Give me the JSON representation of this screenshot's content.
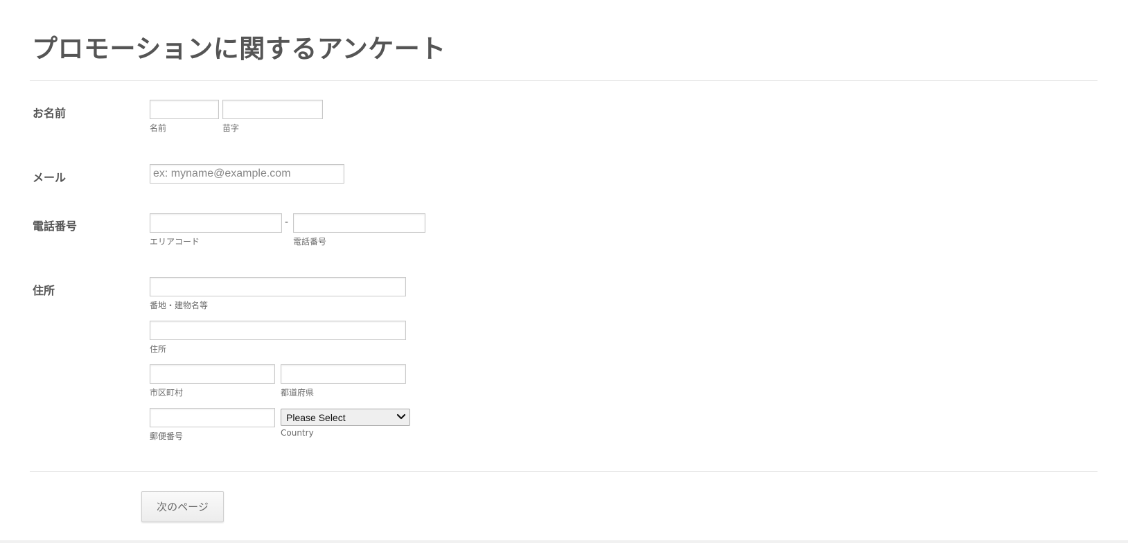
{
  "form": {
    "title": "プロモーションに関するアンケート"
  },
  "name": {
    "label": "お名前",
    "first": {
      "value": "",
      "sublabel": "名前"
    },
    "last": {
      "value": "",
      "sublabel": "苗字"
    }
  },
  "email": {
    "label": "メール",
    "value": "",
    "placeholder": "ex: myname@example.com"
  },
  "phone": {
    "label": "電話番号",
    "separator": "-",
    "area_code": {
      "value": "",
      "sublabel": "エリアコード"
    },
    "number": {
      "value": "",
      "sublabel": "電話番号"
    }
  },
  "address": {
    "label": "住所",
    "street1": {
      "value": "",
      "sublabel": "番地・建物名等"
    },
    "street2": {
      "value": "",
      "sublabel": "住所"
    },
    "city": {
      "value": "",
      "sublabel": "市区町村"
    },
    "state": {
      "value": "",
      "sublabel": "都道府県"
    },
    "postal": {
      "value": "",
      "sublabel": "郵便番号"
    },
    "country": {
      "selected": "Please Select",
      "sublabel": "Country"
    }
  },
  "actions": {
    "next_label": "次のページ"
  },
  "icons": {
    "select_arrow": "chevron-down-icon"
  }
}
